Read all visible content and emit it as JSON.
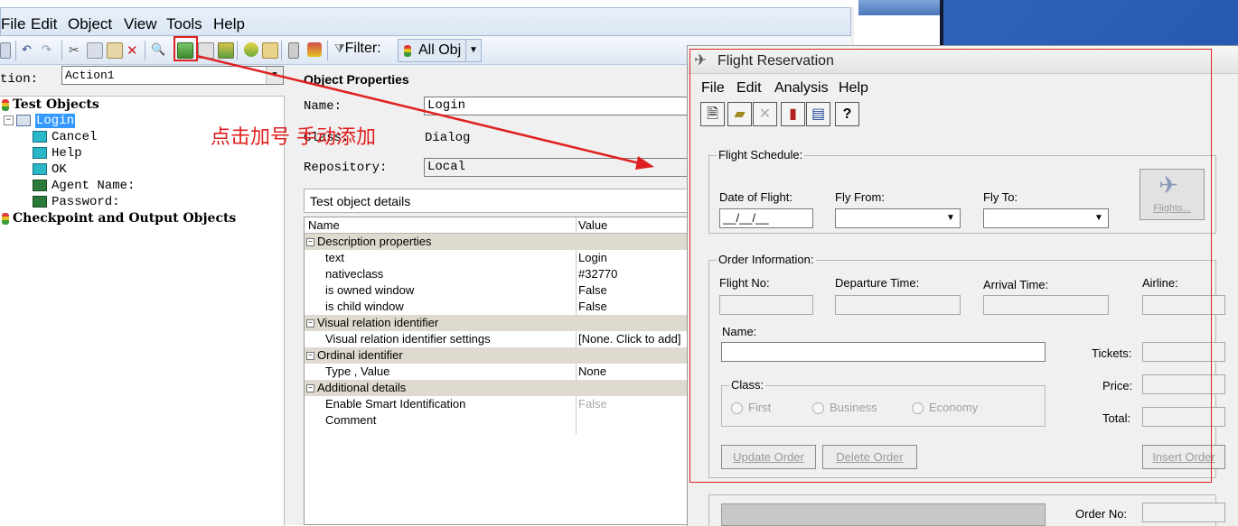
{
  "main": {
    "menu": [
      "File",
      "Edit",
      "Object",
      "View",
      "Tools",
      "Help"
    ],
    "filter_label": "Filter:",
    "filter_value": "All Obj",
    "action_label": "tion:",
    "action_value": "Action1",
    "tree": {
      "root1": "Test Objects",
      "login": "Login",
      "children": [
        "Cancel",
        "Help",
        "OK",
        "Agent Name:",
        "Password:"
      ],
      "root2": "Checkpoint and Output Objects"
    },
    "props": {
      "title": "Object Properties",
      "name_label": "Name:",
      "name_value": "Login",
      "class_label": "Class:",
      "class_value": "Dialog",
      "repo_label": "Repository:",
      "repo_value": "Local",
      "details_title": "Test object details",
      "col_name": "Name",
      "col_value": "Value",
      "rows": [
        {
          "cat": true,
          "name": "Description properties",
          "value": ""
        },
        {
          "cat": false,
          "name": "text",
          "value": "Login"
        },
        {
          "cat": false,
          "name": "nativeclass",
          "value": "#32770"
        },
        {
          "cat": false,
          "name": "is owned window",
          "value": "False"
        },
        {
          "cat": false,
          "name": "is child window",
          "value": "False"
        },
        {
          "cat": true,
          "name": "Visual relation identifier",
          "value": ""
        },
        {
          "cat": false,
          "name": "Visual relation identifier settings",
          "value": "[None. Click to add]"
        },
        {
          "cat": true,
          "name": "Ordinal identifier",
          "value": ""
        },
        {
          "cat": false,
          "name": "Type , Value",
          "value": "None"
        },
        {
          "cat": true,
          "name": "Additional details",
          "value": ""
        },
        {
          "cat": false,
          "name": "Enable Smart Identification",
          "value": "False"
        },
        {
          "cat": false,
          "name": "Comment",
          "value": ""
        }
      ]
    }
  },
  "annotation": "点击加号 手动添加",
  "flight": {
    "title": "Flight Reservation",
    "menu": [
      "File",
      "Edit",
      "Analysis",
      "Help"
    ],
    "schedule_group": "Flight Schedule:",
    "date_label": "Date of Flight:",
    "date_value": "__/__/__",
    "from_label": "Fly From:",
    "to_label": "Fly To:",
    "flights_btn": "Flights...",
    "order_group": "Order Information:",
    "flight_no_label": "Flight No:",
    "departure_label": "Departure Time:",
    "arrival_label": "Arrival Time:",
    "airline_label": "Airline:",
    "name_label": "Name:",
    "tickets_label": "Tickets:",
    "class_group": "Class:",
    "class_first": "First",
    "class_business": "Business",
    "class_economy": "Economy",
    "price_label": "Price:",
    "total_label": "Total:",
    "update_btn": "Update Order",
    "delete_btn": "Delete Order",
    "insert_btn": "Insert Order",
    "order_no_label": "Order No:"
  },
  "colors": {
    "annotation_red": "#e02020",
    "selection": "#3399ff"
  }
}
